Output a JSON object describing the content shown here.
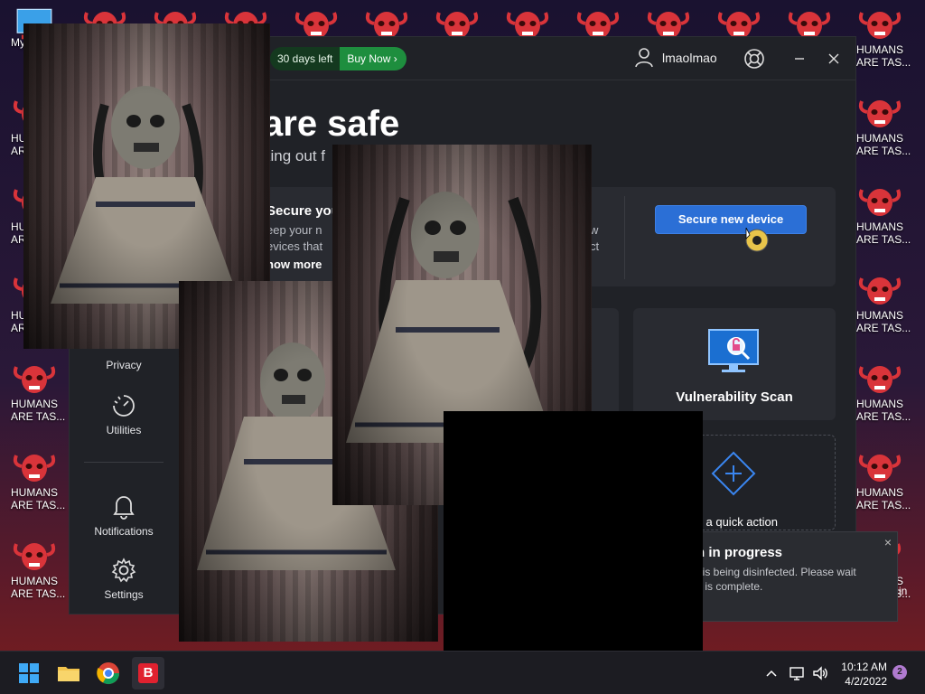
{
  "desktop": {
    "icon_label_line1": "HUMANS",
    "icon_label_line2": "ARE TAS...",
    "this_pc_label": "My C"
  },
  "app": {
    "trial_days": "30 days left",
    "buy_now": "Buy Now",
    "buy_chevron": "›",
    "username": "lmaolmao",
    "hero_title": "are safe",
    "hero_subtitle": "king out f",
    "secure_card": {
      "title": "Secure you",
      "desc_line1": "eep your n",
      "desc_line2": "evices that",
      "desc_tail1": "w",
      "desc_tail2": "ct",
      "show_more": "how more",
      "button": "Secure new device"
    },
    "tiles": {
      "vulnerability_scan": "Vulnerability Scan",
      "add_quick_action": "l a quick action"
    },
    "sidebar": {
      "privacy": "Privacy",
      "utilities": "Utilities",
      "notifications": "Notifications",
      "settings": "Settings"
    },
    "toast": {
      "title": "n in progress",
      "body_line1": "t is being disinfected. Please wait",
      "body_line2": "s is complete.",
      "close": "×",
      "fragment_u": "u",
      "fragment_in": "in"
    }
  },
  "taskbar": {
    "time": "10:12 AM",
    "date": "4/2/2022",
    "notification_count": "2",
    "bitdefender_letter": "B"
  },
  "colors": {
    "accent_blue": "#2b6fd6",
    "trial_green": "#1e8e3e",
    "skull_red": "#d9343a"
  }
}
